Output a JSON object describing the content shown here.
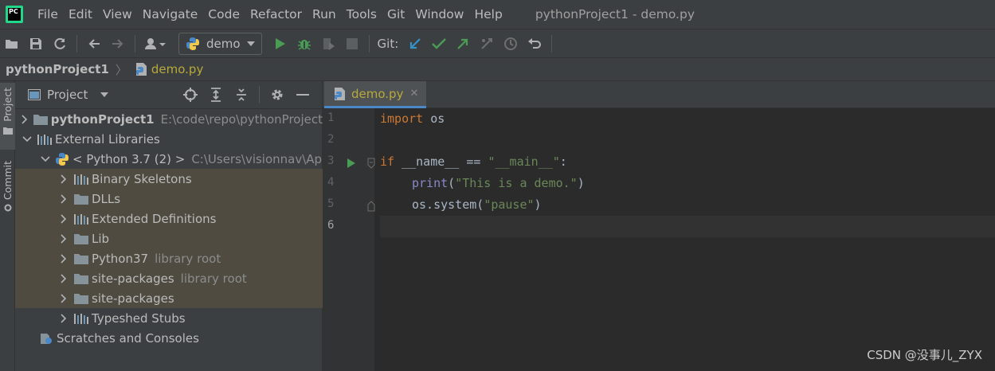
{
  "menubar": {
    "items": [
      "File",
      "Edit",
      "View",
      "Navigate",
      "Code",
      "Refactor",
      "Run",
      "Tools",
      "Git",
      "Window",
      "Help"
    ],
    "window_title": "pythonProject1 - demo.py",
    "logo_text": "PC"
  },
  "toolbar": {
    "run_config": "demo",
    "git_label": "Git:"
  },
  "breadcrumb": {
    "project": "pythonProject1",
    "file": "demo.py"
  },
  "side_tabs": {
    "project": "Project",
    "commit": "Commit"
  },
  "project_panel": {
    "title": "Project",
    "tree": [
      {
        "label": "pythonProject1",
        "sub": "E:\\code\\repo\\pythonProject"
      },
      {
        "label": "External Libraries",
        "sub": ""
      },
      {
        "label": "< Python 3.7 (2) >",
        "sub": "C:\\Users\\visionnav\\App"
      },
      {
        "label": "Binary Skeletons",
        "sub": ""
      },
      {
        "label": "DLLs",
        "sub": ""
      },
      {
        "label": "Extended Definitions",
        "sub": ""
      },
      {
        "label": "Lib",
        "sub": ""
      },
      {
        "label": "Python37",
        "sub": "library root"
      },
      {
        "label": "site-packages",
        "sub": "library root"
      },
      {
        "label": "site-packages",
        "sub": ""
      },
      {
        "label": "Typeshed Stubs",
        "sub": ""
      },
      {
        "label": "Scratches and Consoles",
        "sub": ""
      }
    ]
  },
  "editor": {
    "tab_label": "demo.py",
    "line_numbers": [
      "1",
      "2",
      "3",
      "4",
      "5",
      "6"
    ],
    "code": {
      "l1_kw": "import",
      "l1_rest": " os",
      "l3_kw": "if",
      "l3_a": " __name__ == ",
      "l3_str": "\"__main__\"",
      "l3_b": ":",
      "l4_fn": "print",
      "l4_a": "(",
      "l4_str": "\"This is a demo.\"",
      "l4_b": ")",
      "l5_a": "os.system(",
      "l5_str": "\"pause\"",
      "l5_b": ")"
    }
  },
  "watermark": "CSDN @没事儿_ZYX",
  "colors": {
    "accent_blue": "#4a88c7",
    "run_green": "#499c54",
    "file_yellow": "#b8a93b",
    "keyword": "#cc7832",
    "string": "#6a8759"
  }
}
